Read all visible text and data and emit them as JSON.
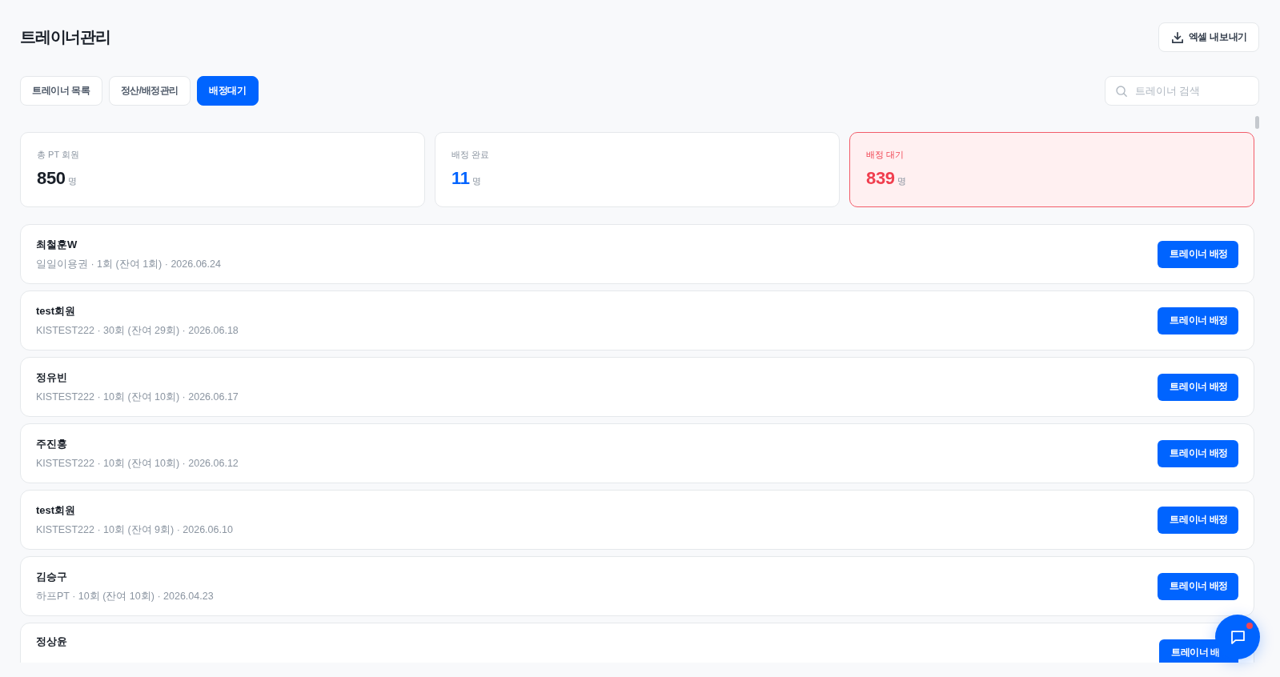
{
  "page": {
    "title": "트레이너관리"
  },
  "export_button": {
    "label": "엑셀 내보내기"
  },
  "tabs": [
    {
      "label": "트레이너 목록",
      "selected": false
    },
    {
      "label": "정산/배정관리",
      "selected": false
    },
    {
      "label": "배정대기",
      "selected": true
    }
  ],
  "search": {
    "placeholder": "트레이너 검색"
  },
  "stats": [
    {
      "kind": "total",
      "label": "총 PT 회원",
      "value": "850",
      "unit": "명"
    },
    {
      "kind": "assigned",
      "label": "배정 완료",
      "value": "11",
      "unit": "명"
    },
    {
      "kind": "waiting",
      "label": "배정 대기",
      "value": "839",
      "unit": "명"
    }
  ],
  "members": [
    {
      "name": "최철훈W",
      "details": "일일이용권 · 1회 (잔여 1회) · 2026.06.24",
      "action": "트레이너 배정"
    },
    {
      "name": "test회원",
      "details": "KISTEST222 · 30회 (잔여 29회) · 2026.06.18",
      "action": "트레이너 배정"
    },
    {
      "name": "정유빈",
      "details": "KISTEST222 · 10회 (잔여 10회) · 2026.06.17",
      "action": "트레이너 배정"
    },
    {
      "name": "주진홍",
      "details": "KISTEST222 · 10회 (잔여 10회) · 2026.06.12",
      "action": "트레이너 배정"
    },
    {
      "name": "test회원",
      "details": "KISTEST222 · 10회 (잔여 9회) · 2026.06.10",
      "action": "트레이너 배정"
    },
    {
      "name": "김승구",
      "details": "하프PT · 10회 (잔여 10회) · 2026.04.23",
      "action": "트레이너 배정"
    },
    {
      "name": "정상윤",
      "action": "트레이너 배"
    }
  ],
  "chat_button": {
    "unread": true
  }
}
